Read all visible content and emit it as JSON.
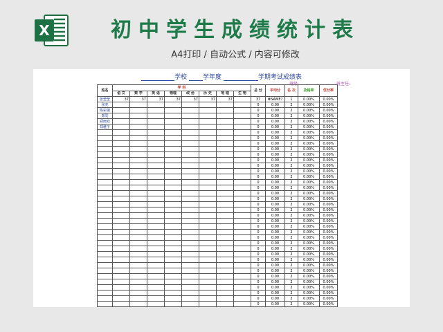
{
  "header": {
    "title": "初中学生成绩统计表",
    "subtitle": "A4打印 / 自动公式 / 内容可修改",
    "logo_letter": "X"
  },
  "sheet": {
    "title_parts": [
      "学校",
      "学年度",
      "学期考试成绩表"
    ],
    "class_label": "班级:",
    "teacher_label": "班主任:"
  },
  "table": {
    "name_header": "姓名",
    "subject_group_header": "学  科",
    "subjects": [
      "语 文",
      "数 学",
      "英 语",
      "物理",
      "政 治",
      "历 史",
      "地 理",
      "生 物"
    ],
    "summary_headers": [
      "总 分",
      "平均分",
      "名 次",
      "及格率",
      "优分率"
    ],
    "students": [
      {
        "name": "张莹莹",
        "scores": [
          "37",
          "37",
          "37",
          "37",
          "37",
          "37",
          "37",
          ""
        ],
        "total": "37",
        "avg": "#NAME?",
        "rank": "1",
        "pass": "0.00%",
        "excellent": "0.00%"
      },
      {
        "name": "张充",
        "scores": [
          "",
          "",
          "",
          "",
          "",
          "",
          "",
          ""
        ],
        "total": "0",
        "avg": "0.00",
        "rank": "2",
        "pass": "0.00%",
        "excellent": "0.00%"
      },
      {
        "name": "陈彩丽",
        "scores": [
          "",
          "",
          "",
          "",
          "",
          "",
          "",
          ""
        ],
        "total": "0",
        "avg": "0.00",
        "rank": "2",
        "pass": "0.00%",
        "excellent": "0.00%"
      },
      {
        "name": "郑同",
        "scores": [
          "",
          "",
          "",
          "",
          "",
          "",
          "",
          ""
        ],
        "total": "0",
        "avg": "0.00",
        "rank": "2",
        "pass": "0.00%",
        "excellent": "0.00%"
      },
      {
        "name": "郑雨欢",
        "scores": [
          "",
          "",
          "",
          "",
          "",
          "",
          "",
          ""
        ],
        "total": "0",
        "avg": "0.00",
        "rank": "2",
        "pass": "0.00%",
        "excellent": "0.00%"
      },
      {
        "name": "郑雅子",
        "scores": [
          "",
          "",
          "",
          "",
          "",
          "",
          "",
          ""
        ],
        "total": "0",
        "avg": "0.00",
        "rank": "2",
        "pass": "0.00%",
        "excellent": "0.00%"
      }
    ],
    "empty_row": {
      "total": "0",
      "avg": "0.00",
      "rank": "2",
      "pass": "0.00%",
      "excellent": "0.00%"
    },
    "empty_row_count": 33
  },
  "colors": {
    "title_green": "#1f7a4a",
    "excel_green": "#1e7145",
    "sheet_blue": "#2e4a9c",
    "header_red": "#c0392b",
    "pass_green": "#3a9a2a"
  }
}
